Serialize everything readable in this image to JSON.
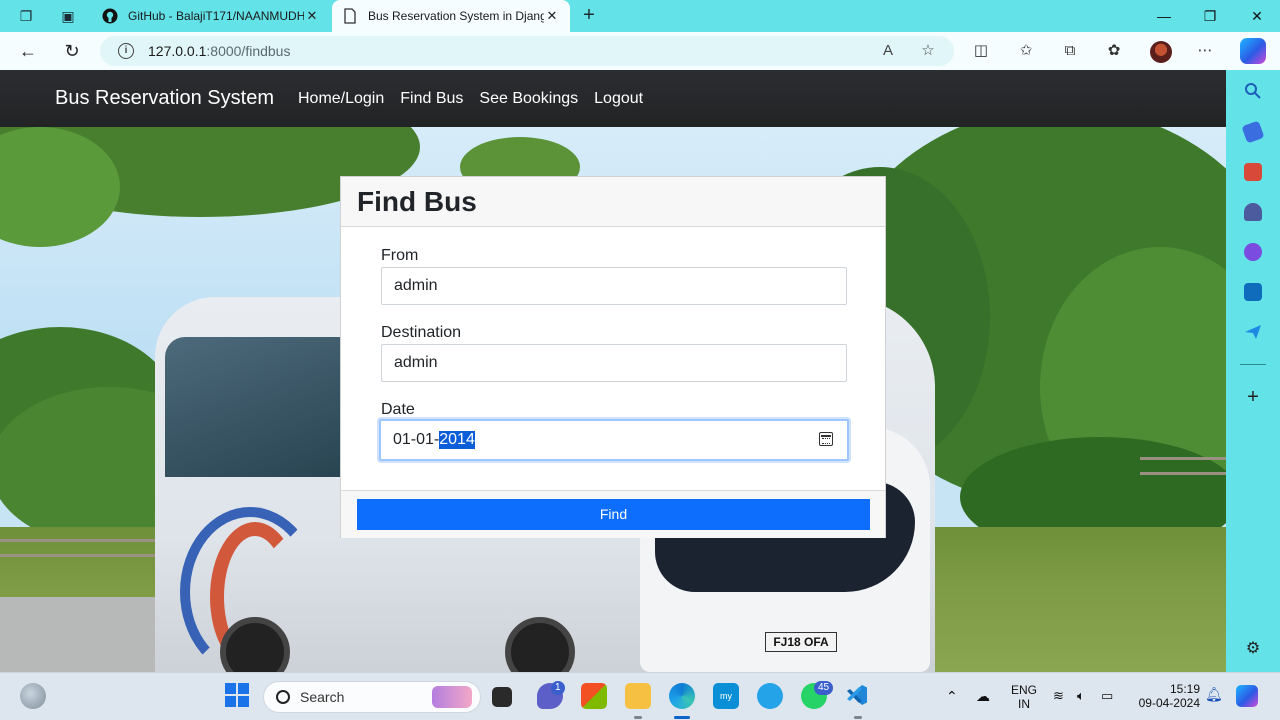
{
  "browser": {
    "tabs": [
      {
        "title": "GitHub - BalajiT171/NAANMUDH"
      },
      {
        "title": "Bus Reservation System in Djang"
      }
    ],
    "address": {
      "host": "127.0.0.1",
      "path": ":8000/findbus"
    }
  },
  "site": {
    "brand": "Bus Reservation System",
    "nav": [
      "Home/Login",
      "Find Bus",
      "See Bookings",
      "Logout"
    ]
  },
  "form": {
    "title": "Find Bus",
    "from_label": "From",
    "from_value": "admin",
    "destination_label": "Destination",
    "destination_value": "admin",
    "date_label": "Date",
    "date_value_prefix": "01-01-",
    "date_value_selected": "2014",
    "submit_label": "Find"
  },
  "scene": {
    "plate": "FJ18 OFA"
  },
  "taskbar": {
    "search_placeholder": "Search",
    "teams_badge": "1",
    "whatsapp_badge": "45",
    "language_line1": "ENG",
    "language_line2": "IN",
    "time": "15:19",
    "date": "09-04-2024"
  },
  "colors": {
    "accent": "#0d6efd",
    "navbar": "#212529",
    "browser_frame": "#63e2e8"
  }
}
